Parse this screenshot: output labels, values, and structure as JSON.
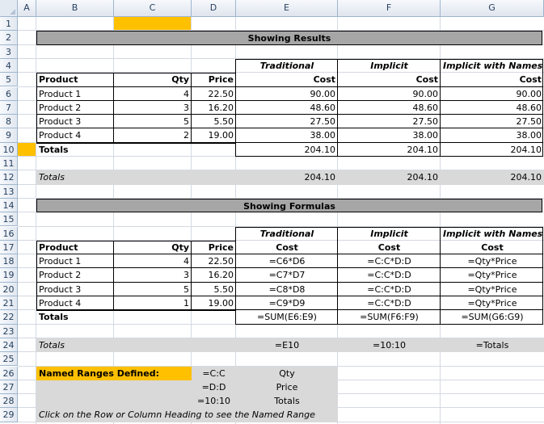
{
  "columns": [
    "A",
    "B",
    "C",
    "D",
    "E",
    "F",
    "G"
  ],
  "rows": [
    "1",
    "2",
    "3",
    "4",
    "5",
    "6",
    "7",
    "8",
    "9",
    "10",
    "11",
    "12",
    "13",
    "14",
    "15",
    "16",
    "17",
    "18",
    "19",
    "20",
    "21",
    "22",
    "23",
    "24",
    "25",
    "26",
    "27",
    "28",
    "29"
  ],
  "colors": {
    "highlight": "#ffc000",
    "banner": "#a6a6a6",
    "band": "#d9d9d9",
    "grid": "#d4d9e2",
    "header_text": "#27415f"
  },
  "results": {
    "banner": "Showing Results",
    "method_headers": [
      "Traditional",
      "Implicit",
      "Implicit with Names"
    ],
    "col_headers": [
      "Product",
      "Qty",
      "Price",
      "Cost",
      "Cost",
      "Cost"
    ],
    "rows": [
      [
        "Product 1",
        "4",
        "22.50",
        "90.00",
        "90.00",
        "90.00"
      ],
      [
        "Product 2",
        "3",
        "16.20",
        "48.60",
        "48.60",
        "48.60"
      ],
      [
        "Product 3",
        "5",
        "5.50",
        "27.50",
        "27.50",
        "27.50"
      ],
      [
        "Product 4",
        "2",
        "19.00",
        "38.00",
        "38.00",
        "38.00"
      ]
    ],
    "totals_label": "Totals",
    "totals": [
      "204.10",
      "204.10",
      "204.10"
    ],
    "italic_totals_label": "Totals",
    "italic_totals": [
      "204.10",
      "204.10",
      "204.10"
    ]
  },
  "formulas": {
    "banner": "Showing Formulas",
    "method_headers": [
      "Traditional",
      "Implicit",
      "Implicit with Names"
    ],
    "col_headers": [
      "Product",
      "Qty",
      "Price",
      "Cost",
      "Cost",
      "Cost"
    ],
    "rows": [
      [
        "Product 1",
        "4",
        "22.50",
        "=C6*D6",
        "=C:C*D:D",
        "=Qty*Price"
      ],
      [
        "Product 2",
        "3",
        "16.20",
        "=C7*D7",
        "=C:C*D:D",
        "=Qty*Price"
      ],
      [
        "Product 3",
        "5",
        "5.50",
        "=C8*D8",
        "=C:C*D:D",
        "=Qty*Price"
      ],
      [
        "Product 4",
        "1",
        "19.00",
        "=C9*D9",
        "=C:C*D:D",
        "=Qty*Price"
      ]
    ],
    "totals_label": "Totals",
    "totals": [
      "=SUM(E6:E9)",
      "=SUM(F6:F9)",
      "=SUM(G6:G9)"
    ],
    "italic_totals_label": "Totals",
    "italic_totals": [
      "=E10",
      "=10:10",
      "=Totals"
    ]
  },
  "named_ranges": {
    "title": "Named Ranges Defined:",
    "items": [
      {
        "range": "=C:C",
        "name": "Qty"
      },
      {
        "range": "=D:D",
        "name": "Price"
      },
      {
        "range": "=10:10",
        "name": "Totals"
      }
    ],
    "note": "Click on the Row or Column Heading to see the Named Range"
  }
}
